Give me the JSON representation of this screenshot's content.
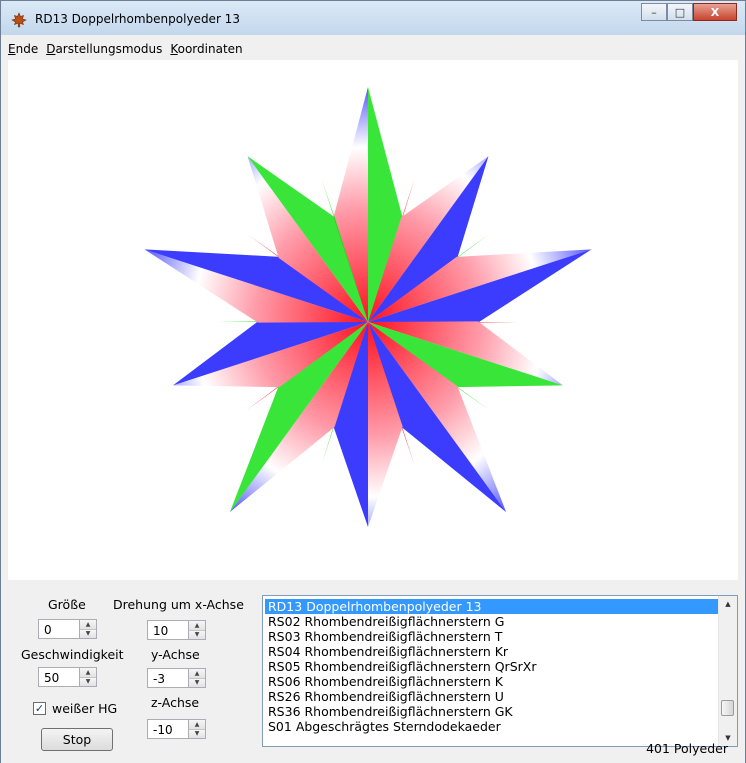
{
  "window": {
    "title": "RD13 Doppelrhombenpolyeder 13",
    "icon": "maple-leaf-icon",
    "buttons": {
      "minimize": "–",
      "maximize": "□",
      "close": "X"
    }
  },
  "menu": [
    {
      "underline": "E",
      "rest": "nde"
    },
    {
      "underline": "D",
      "rest": "arstellungsmodus"
    },
    {
      "underline": "K",
      "rest": "oordinaten"
    }
  ],
  "polyhedron": {
    "description_colors": {
      "red": "#ff1020",
      "green": "#18e018",
      "blue": "#1a1aff",
      "white": "#ffffff"
    }
  },
  "controls": {
    "groesse_label": "Größe",
    "groesse_value": "0",
    "geschwindigkeit_label": "Geschwindigkeit",
    "geschwindigkeit_value": "50",
    "x_label": "Drehung um x-Achse",
    "x_value": "10",
    "y_label": "y-Achse",
    "y_value": "-3",
    "z_label": "z-Achse",
    "z_value": "-10",
    "weisser_hg_label": "weißer HG",
    "weisser_hg_checked": "✓",
    "stop_label": "Stop"
  },
  "list": {
    "items": [
      "RD13 Doppelrhombenpolyeder 13",
      "RS02 Rhombendreißigflächnerstern G",
      "RS03 Rhombendreißigflächnerstern T",
      "RS04 Rhombendreißigflächnerstern Kr",
      "RS05 Rhombendreißigflächnerstern QrSrXr",
      "RS06 Rhombendreißigflächnerstern K",
      "RS26 Rhombendreißigflächnerstern U",
      "RS36 Rhombendreißigflächnerstern GK",
      "S01 Abgeschrägtes Sterndodekaeder"
    ],
    "selected_index": 0
  },
  "status": {
    "count": "401 Polyeder"
  }
}
